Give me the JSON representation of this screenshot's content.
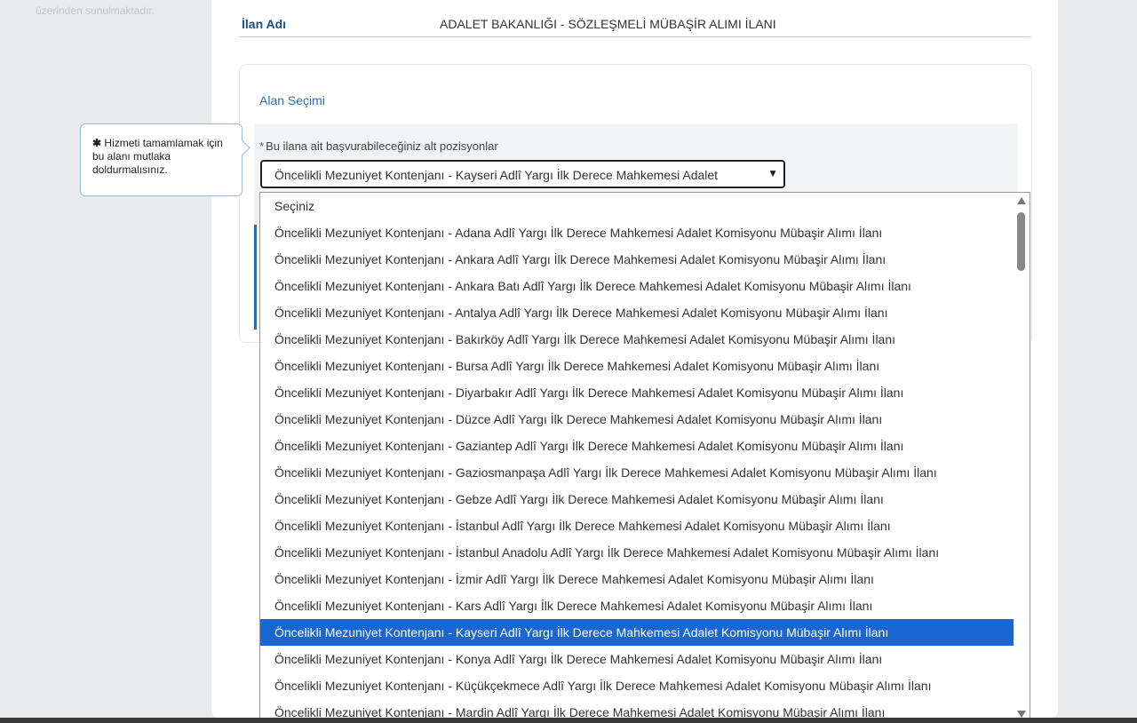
{
  "left_panel": {
    "note": "üzerinden sunulmaktadır."
  },
  "ilan": {
    "label": "İlan Adı",
    "value": "ADALET BAKANLIĞI - SÖZLEŞMELİ MÜBAŞİR ALIMI İLANI"
  },
  "section": {
    "title": "Alan Seçimi",
    "field_required_mark": "*",
    "field_label": "Bu ilana ait başvurabileceğiniz alt pozisyonlar",
    "selected_value": "Öncelikli Mezuniyet Kontenjanı - Kayseri Adlî Yargı İlk Derece Mahkemesi Adalet"
  },
  "tooltip": {
    "asterisk": "✱",
    "text": "Hizmeti tamamlamak için bu alanı mutlaka doldurmalısınız."
  },
  "dropdown": {
    "options": [
      "Seçiniz",
      "Öncelikli Mezuniyet Kontenjanı - Adana Adlî Yargı İlk Derece Mahkemesi Adalet Komisyonu Mübaşir Alımı İlanı",
      "Öncelikli Mezuniyet Kontenjanı - Ankara Adlî Yargı İlk Derece Mahkemesi Adalet Komisyonu Mübaşir Alımı İlanı",
      "Öncelikli Mezuniyet Kontenjanı - Ankara Batı Adlî Yargı İlk Derece Mahkemesi Adalet Komisyonu Mübaşir Alımı İlanı",
      "Öncelikli Mezuniyet Kontenjanı - Antalya Adlî Yargı İlk Derece Mahkemesi Adalet Komisyonu Mübaşir Alımı İlanı",
      "Öncelikli Mezuniyet Kontenjanı - Bakırköy Adlî Yargı İlk Derece Mahkemesi Adalet Komisyonu Mübaşir Alımı İlanı",
      "Öncelikli Mezuniyet Kontenjanı - Bursa Adlî Yargı İlk Derece Mahkemesi Adalet Komisyonu Mübaşir Alımı İlanı",
      "Öncelikli Mezuniyet Kontenjanı - Diyarbakır Adlî Yargı İlk Derece Mahkemesi Adalet Komisyonu Mübaşir Alımı İlanı",
      "Öncelikli Mezuniyet Kontenjanı - Düzce Adlî Yargı İlk Derece Mahkemesi Adalet Komisyonu Mübaşir Alımı İlanı",
      "Öncelikli Mezuniyet Kontenjanı - Gaziantep Adlî Yargı İlk Derece Mahkemesi Adalet Komisyonu Mübaşir Alımı İlanı",
      "Öncelikli Mezuniyet Kontenjanı - Gaziosmanpaşa Adlî Yargı İlk Derece Mahkemesi Adalet Komisyonu Mübaşir Alımı İlanı",
      "Öncelikli Mezuniyet Kontenjanı - Gebze Adlî Yargı İlk Derece Mahkemesi Adalet Komisyonu Mübaşir Alımı İlanı",
      "Öncelikli Mezuniyet Kontenjanı - İstanbul Adlî Yargı İlk Derece Mahkemesi Adalet Komisyonu Mübaşir Alımı İlanı",
      "Öncelikli Mezuniyet Kontenjanı - İstanbul Anadolu Adlî Yargı İlk Derece Mahkemesi Adalet Komisyonu Mübaşir Alımı İlanı",
      "Öncelikli Mezuniyet Kontenjanı - İzmir Adlî Yargı İlk Derece Mahkemesi Adalet Komisyonu Mübaşir Alımı İlanı",
      "Öncelikli Mezuniyet Kontenjanı - Kars Adlî Yargı İlk Derece Mahkemesi Adalet Komisyonu Mübaşir Alımı İlanı",
      "Öncelikli Mezuniyet Kontenjanı - Kayseri Adlî Yargı İlk Derece Mahkemesi Adalet Komisyonu Mübaşir Alımı İlanı",
      "Öncelikli Mezuniyet Kontenjanı - Konya Adlî Yargı İlk Derece Mahkemesi Adalet Komisyonu Mübaşir Alımı İlanı",
      "Öncelikli Mezuniyet Kontenjanı - Küçükçekmece Adlî Yargı İlk Derece Mahkemesi Adalet Komisyonu Mübaşir Alımı İlanı",
      "Öncelikli Mezuniyet Kontenjanı - Mardin Adlî Yargı İlk Derece Mahkemesi Adalet Komisyonu Mübaşir Alımı İlanı"
    ],
    "selected_index": 16
  },
  "colors": {
    "accent": "#2a6bb5",
    "selected_bg": "#1a66d2"
  }
}
